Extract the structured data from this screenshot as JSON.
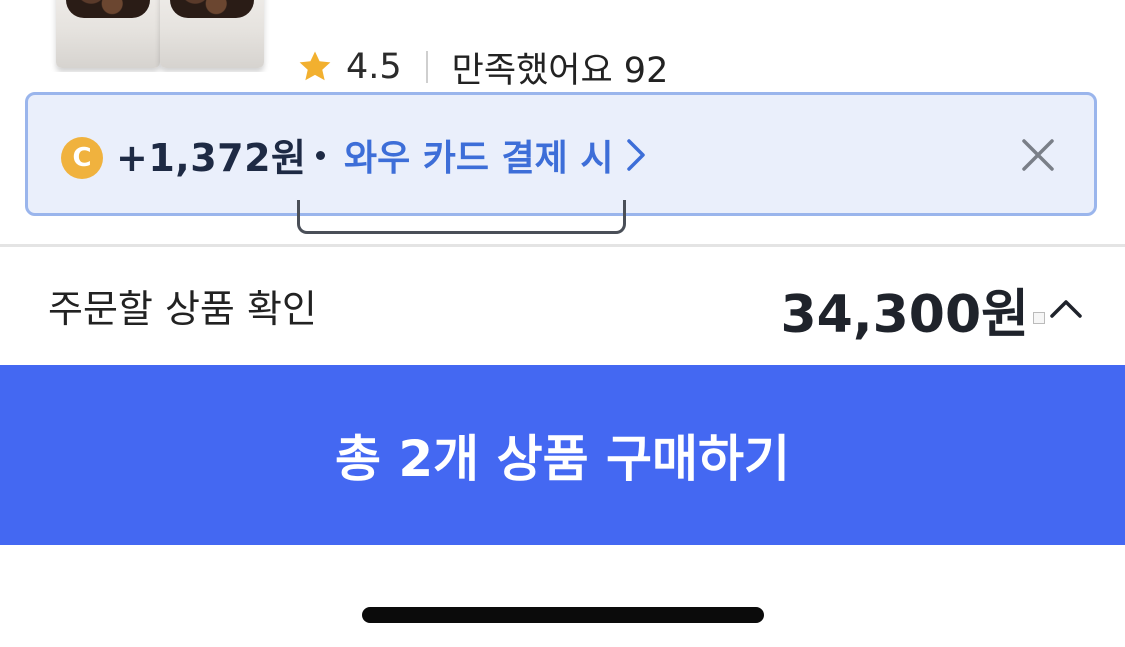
{
  "product": {
    "rating": "4.5",
    "satisfied_text": "만족했어요 92"
  },
  "cashback": {
    "coin_letter": "C",
    "amount": "+1,372원",
    "link_text": "와우 카드 결제 시",
    "coin_color": "#f0b23e",
    "link_color": "#3d6ed8"
  },
  "order_summary": {
    "label": "주문할 상품 확인",
    "total_price": "34,300원"
  },
  "purchase": {
    "button_label": "총 2개 상품 구매하기",
    "button_color": "#4468f2"
  },
  "icons": {
    "star": "star-icon",
    "coin": "coin-icon",
    "chevron_right": "chevron-right-icon",
    "close": "close-icon",
    "chevron_up": "chevron-up-icon"
  }
}
